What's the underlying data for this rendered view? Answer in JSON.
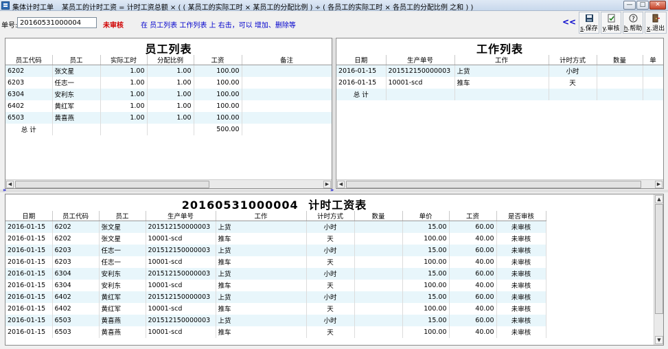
{
  "window": {
    "title": "集体计时工单",
    "formula": "某员工的计时工资 = 计时工资总额 × ( ( 某员工的实际工时 × 某员工的分配比例 ) ÷ ( 各员工的实际工时 × 各员工的分配比例 之和 ) )"
  },
  "toolbar": {
    "order_label": "单号:",
    "order_value": "20160531000004",
    "status": "未审核",
    "hint": "在 员工列表 工作列表 上 右击，可以 增加、删除等",
    "collapse": "<<",
    "buttons": [
      {
        "key": "s",
        "label": "保存",
        "icon": "save-icon"
      },
      {
        "key": "y",
        "label": "审核",
        "icon": "audit-icon"
      },
      {
        "key": "h",
        "label": "帮助",
        "icon": "help-icon"
      },
      {
        "key": "x",
        "label": "退出",
        "icon": "exit-icon"
      }
    ]
  },
  "employee_panel": {
    "title": "员工列表",
    "headers": [
      "员工代码",
      "员工",
      "实际工时",
      "分配比例",
      "工资",
      "备注"
    ],
    "rows": [
      [
        "6202",
        "张文星",
        "1.00",
        "1.00",
        "100.00",
        ""
      ],
      [
        "6203",
        "任志一",
        "1.00",
        "1.00",
        "100.00",
        ""
      ],
      [
        "6304",
        "安利东",
        "1.00",
        "1.00",
        "100.00",
        ""
      ],
      [
        "6402",
        "黄红军",
        "1.00",
        "1.00",
        "100.00",
        ""
      ],
      [
        "6503",
        "黄喜燕",
        "1.00",
        "1.00",
        "100.00",
        ""
      ]
    ],
    "total": {
      "label": "总  计",
      "wage": "500.00"
    }
  },
  "work_panel": {
    "title": "工作列表",
    "headers": [
      "日期",
      "生产单号",
      "工作",
      "计时方式",
      "数量",
      "单"
    ],
    "rows": [
      [
        "2016-01-15",
        "201512150000003",
        "上货",
        "小时",
        "",
        ""
      ],
      [
        "2016-01-15",
        "10001-scd",
        "推车",
        "天",
        "",
        ""
      ]
    ],
    "total": {
      "label": "总  计"
    }
  },
  "wage_panel": {
    "title_number": "20160531000004",
    "title_text": "计时工资表",
    "headers": [
      "日期",
      "员工代码",
      "员工",
      "生产单号",
      "工作",
      "计时方式",
      "数量",
      "单价",
      "工资",
      "是否审核"
    ],
    "rows": [
      [
        "2016-01-15",
        "6202",
        "张文星",
        "201512150000003",
        "上货",
        "小时",
        "",
        "15.00",
        "60.00",
        "未审核"
      ],
      [
        "2016-01-15",
        "6202",
        "张文星",
        "10001-scd",
        "推车",
        "天",
        "",
        "100.00",
        "40.00",
        "未审核"
      ],
      [
        "2016-01-15",
        "6203",
        "任志一",
        "201512150000003",
        "上货",
        "小时",
        "",
        "15.00",
        "60.00",
        "未审核"
      ],
      [
        "2016-01-15",
        "6203",
        "任志一",
        "10001-scd",
        "推车",
        "天",
        "",
        "100.00",
        "40.00",
        "未审核"
      ],
      [
        "2016-01-15",
        "6304",
        "安利东",
        "201512150000003",
        "上货",
        "小时",
        "",
        "15.00",
        "60.00",
        "未审核"
      ],
      [
        "2016-01-15",
        "6304",
        "安利东",
        "10001-scd",
        "推车",
        "天",
        "",
        "100.00",
        "40.00",
        "未审核"
      ],
      [
        "2016-01-15",
        "6402",
        "黄红军",
        "201512150000003",
        "上货",
        "小时",
        "",
        "15.00",
        "60.00",
        "未审核"
      ],
      [
        "2016-01-15",
        "6402",
        "黄红军",
        "10001-scd",
        "推车",
        "天",
        "",
        "100.00",
        "40.00",
        "未审核"
      ],
      [
        "2016-01-15",
        "6503",
        "黄喜燕",
        "201512150000003",
        "上货",
        "小时",
        "",
        "15.00",
        "60.00",
        "未审核"
      ],
      [
        "2016-01-15",
        "6503",
        "黄喜燕",
        "10001-scd",
        "推车",
        "天",
        "",
        "100.00",
        "40.00",
        "未审核"
      ]
    ]
  },
  "colors": {
    "status_red": "#d00000",
    "hint_blue": "#0000cc",
    "row_alt": "#e8f6fb"
  }
}
